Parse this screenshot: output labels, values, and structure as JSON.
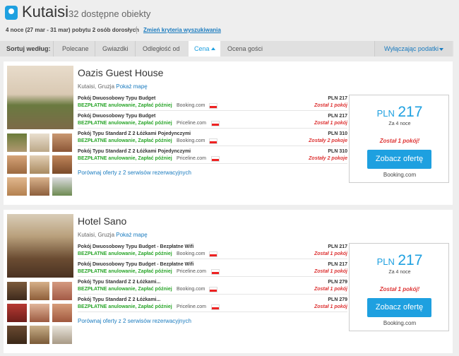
{
  "header": {
    "city": "Kutaisi",
    "count": "32 dostępne obiekty",
    "subline": "4 noce (27 mar - 31 mar) pobytu 2 osób dorosłych",
    "change_link": "Zmień kryteria wyszukiwania"
  },
  "sort": {
    "label": "Sortuj według:",
    "items": [
      "Polecane",
      "Gwiazdki",
      "Odległość od",
      "Cena",
      "Ocena gości"
    ],
    "active": "Cena",
    "tax_label": "Wyłączając podatki"
  },
  "hotels": [
    {
      "name": "Oazis Guest House",
      "location": "Kutaisi, Gruzja",
      "map_link": "Pokaż mapę",
      "offers": [
        {
          "room": "Pokój Dwuosobowy Typu Budget",
          "free": "BEZPŁATNE anulowanie, Zapłać później",
          "source": "Booking.com",
          "price": "PLN 217",
          "left": "Został 1 pokój"
        },
        {
          "room": "Pokój Dwuosobowy Typu Budget",
          "free": "BEZPŁATNE anulowanie, Zapłać później",
          "source": "Priceline.com",
          "price": "PLN 217",
          "left": "Został 1 pokój"
        },
        {
          "room": "Pokój Typu Standard Z 2 Łóżkami Pojedynczymi",
          "free": "BEZPŁATNE anulowanie, Zapłać później",
          "source": "Booking.com",
          "price": "PLN 310",
          "left": "Zostały 2 pokoje"
        },
        {
          "room": "Pokój Typu Standard Z 2 Łóżkami Pojedynczymi",
          "free": "BEZPŁATNE anulowanie, Zapłać później",
          "source": "Priceline.com",
          "price": "PLN 310",
          "left": "Zostały 2 pokoje"
        }
      ],
      "compare": "Porównaj oferty z 2 serwisów rezerwacyjnych",
      "box": {
        "currency": "PLN",
        "amount": "217",
        "nights": "Za 4 noce",
        "left": "Został 1 pokój!",
        "button": "Zobacz ofertę",
        "source": "Booking.com"
      }
    },
    {
      "name": "Hotel Sano",
      "location": "Kutaisi, Gruzja",
      "map_link": "Pokaż mapę",
      "offers": [
        {
          "room": "Pokój Dwuosobowy Typu Budget - Bezpłatne Wifi",
          "free": "BEZPŁATNE anulowanie, Zapłać później",
          "source": "Booking.com",
          "price": "PLN 217",
          "left": "Został 1 pokój"
        },
        {
          "room": "Pokój Dwuosobowy Typu Budget - Bezpłatne Wifi",
          "free": "BEZPŁATNE anulowanie, Zapłać później",
          "source": "Priceline.com",
          "price": "PLN 217",
          "left": "Został 1 pokój"
        },
        {
          "room": "Pokój Typu Standard Z 2 Łóżkami...",
          "free": "BEZPŁATNE anulowanie, Zapłać później",
          "source": "Booking.com",
          "price": "PLN 279",
          "left": "Został 1 pokój"
        },
        {
          "room": "Pokój Typu Standard Z 2 Łóżkami...",
          "free": "BEZPŁATNE anulowanie, Zapłać później",
          "source": "Priceline.com",
          "price": "PLN 279",
          "left": "Został 1 pokój"
        }
      ],
      "compare": "Porównaj oferty z 2 serwisów rezerwacyjnych",
      "box": {
        "currency": "PLN",
        "amount": "217",
        "nights": "Za 4 noce",
        "left": "Został 1 pokój!",
        "button": "Zobacz ofertę",
        "source": "Booking.com"
      }
    }
  ],
  "colors": {
    "accent": "#1ea0e0",
    "green": "#2aa52a",
    "red": "#d33333"
  }
}
